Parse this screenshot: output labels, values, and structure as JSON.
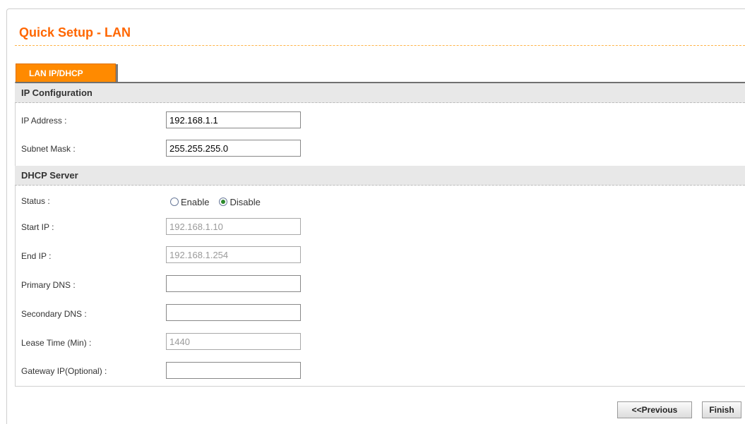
{
  "page": {
    "title": "Quick Setup - LAN"
  },
  "tab": {
    "label": "LAN IP/DHCP"
  },
  "ip_config": {
    "header": "IP Configuration",
    "ip_address_label": "IP Address :",
    "ip_address_value": "192.168.1.1",
    "subnet_mask_label": "Subnet Mask :",
    "subnet_mask_value": "255.255.255.0"
  },
  "dhcp": {
    "header": "DHCP Server",
    "status_label": "Status :",
    "status_options": [
      "Enable",
      "Disable"
    ],
    "status_selected": "Disable",
    "start_ip_label": "Start IP :",
    "start_ip_value": "192.168.1.10",
    "end_ip_label": "End IP :",
    "end_ip_value": "192.168.1.254",
    "primary_dns_label": "Primary DNS :",
    "primary_dns_value": "",
    "secondary_dns_label": "Secondary DNS :",
    "secondary_dns_value": "",
    "lease_time_label": "Lease Time (Min) :",
    "lease_time_value": "1440",
    "gateway_label": "Gateway IP(Optional) :",
    "gateway_value": ""
  },
  "buttons": {
    "previous": "<<Previous",
    "finish": "Finish"
  },
  "colors": {
    "accent": "#ff6600",
    "tab": "#ff8a00",
    "section_bg": "#e8e8e8"
  }
}
